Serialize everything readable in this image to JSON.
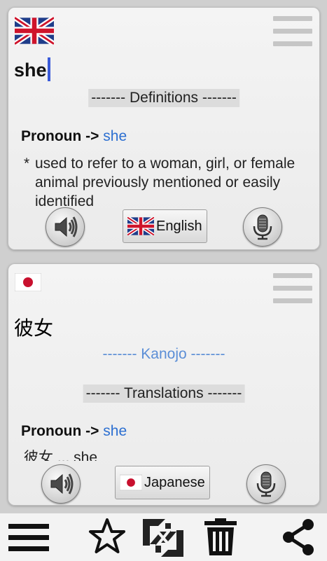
{
  "source_panel": {
    "word": "she",
    "section_heading": "------- Definitions -------",
    "part_of_speech": "Pronoun",
    "arrow": "->",
    "pos_word": "she",
    "definition_bullet": "*",
    "definition_text": "used to refer to a woman, girl, or female animal previously mentioned or easily identified",
    "language_label": "English",
    "flag_icon": "uk-flag-icon"
  },
  "target_panel": {
    "word": "彼女",
    "romanization": "------- Kanojo -------",
    "section_heading": "------- Translations -------",
    "part_of_speech": "Pronoun",
    "arrow": "->",
    "pos_word": "she",
    "translation_line": "彼女 ... she",
    "language_label": "Japanese",
    "flag_icon": "japan-flag-icon"
  },
  "toolbar": {
    "items": [
      "menu-icon",
      "star-icon",
      "swap-languages-icon",
      "trash-icon",
      "share-icon"
    ]
  },
  "colors": {
    "link": "#2c6fd1",
    "romanization": "#5b8ed6",
    "caret": "#3a5bd9"
  }
}
